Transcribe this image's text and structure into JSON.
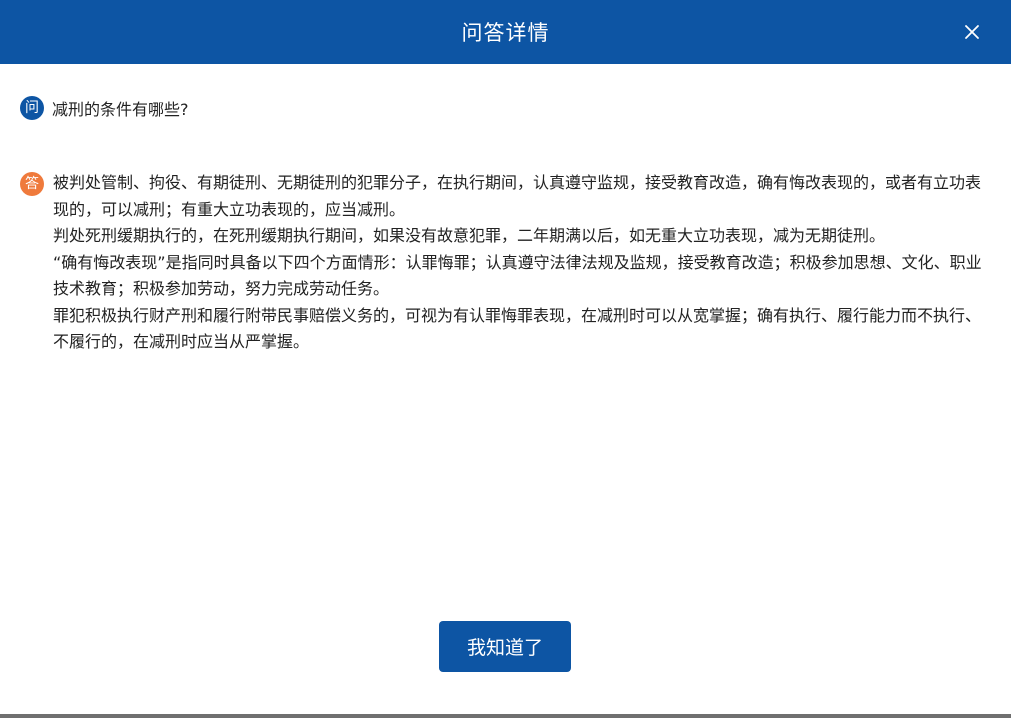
{
  "dialog": {
    "title": "问答详情",
    "close_icon": "close-icon"
  },
  "question": {
    "badge": "问",
    "text": "减刑的条件有哪些?"
  },
  "answer": {
    "badge": "答",
    "paragraphs": [
      "被判处管制、拘役、有期徒刑、无期徒刑的犯罪分子，在执行期间，认真遵守监规，接受教育改造，确有悔改表现的，或者有立功表现的，可以减刑；有重大立功表现的，应当减刑。",
      "判处死刑缓期执行的，在死刑缓期执行期间，如果没有故意犯罪，二年期满以后，如无重大立功表现，减为无期徒刑。",
      "“确有悔改表现”是指同时具备以下四个方面情形：认罪悔罪；认真遵守法律法规及监规，接受教育改造；积极参加思想、文化、职业技术教育；积极参加劳动，努力完成劳动任务。",
      "罪犯积极执行财产刑和履行附带民事赔偿义务的，可视为有认罪悔罪表现，在减刑时可以从宽掌握；确有执行、履行能力而不执行、不履行的，在减刑时应当从严掌握。"
    ]
  },
  "footer": {
    "ok_label": "我知道了"
  },
  "colors": {
    "primary": "#0d55a4",
    "answer_badge": "#ef7a3c"
  }
}
